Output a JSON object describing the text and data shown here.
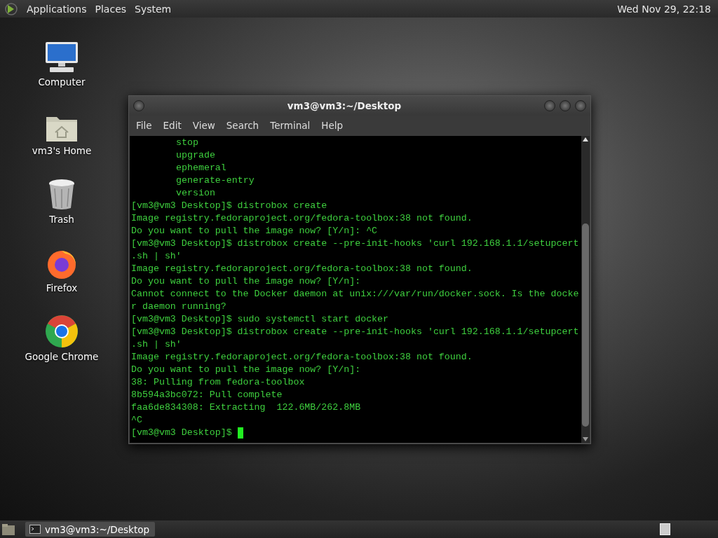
{
  "top_panel": {
    "menus": [
      "Applications",
      "Places",
      "System"
    ],
    "clock": "Wed Nov 29, 22:18"
  },
  "desktop_icons": [
    {
      "kind": "computer",
      "label": "Computer"
    },
    {
      "kind": "home",
      "label": "vm3's Home"
    },
    {
      "kind": "trash",
      "label": "Trash"
    },
    {
      "kind": "firefox",
      "label": "Firefox"
    },
    {
      "kind": "chrome",
      "label": "Google Chrome"
    }
  ],
  "window": {
    "title": "vm3@vm3:~/Desktop",
    "menu": [
      "File",
      "Edit",
      "View",
      "Search",
      "Terminal",
      "Help"
    ],
    "lines": [
      {
        "kind": "indented",
        "text": "stop"
      },
      {
        "kind": "indented",
        "text": "upgrade"
      },
      {
        "kind": "indented",
        "text": "ephemeral"
      },
      {
        "kind": "indented",
        "text": "generate-entry"
      },
      {
        "kind": "indented",
        "text": "version"
      },
      {
        "kind": "plain",
        "text": "[vm3@vm3 Desktop]$ distrobox create"
      },
      {
        "kind": "plain",
        "text": "Image registry.fedoraproject.org/fedora-toolbox:38 not found."
      },
      {
        "kind": "plain",
        "text": "Do you want to pull the image now? [Y/n]: ^C"
      },
      {
        "kind": "plain",
        "text": "[vm3@vm3 Desktop]$ distrobox create --pre-init-hooks 'curl 192.168.1.1/setupcert"
      },
      {
        "kind": "plain",
        "text": ".sh | sh'"
      },
      {
        "kind": "plain",
        "text": "Image registry.fedoraproject.org/fedora-toolbox:38 not found."
      },
      {
        "kind": "plain",
        "text": "Do you want to pull the image now? [Y/n]:"
      },
      {
        "kind": "plain",
        "text": "Cannot connect to the Docker daemon at unix:///var/run/docker.sock. Is the docke"
      },
      {
        "kind": "plain",
        "text": "r daemon running?"
      },
      {
        "kind": "plain",
        "text": "[vm3@vm3 Desktop]$ sudo systemctl start docker"
      },
      {
        "kind": "plain",
        "text": "[vm3@vm3 Desktop]$ distrobox create --pre-init-hooks 'curl 192.168.1.1/setupcert"
      },
      {
        "kind": "plain",
        "text": ".sh | sh'"
      },
      {
        "kind": "plain",
        "text": "Image registry.fedoraproject.org/fedora-toolbox:38 not found."
      },
      {
        "kind": "plain",
        "text": "Do you want to pull the image now? [Y/n]:"
      },
      {
        "kind": "plain",
        "text": "38: Pulling from fedora-toolbox"
      },
      {
        "kind": "plain",
        "text": "8b594a3bc072: Pull complete"
      },
      {
        "kind": "plain",
        "text": "faa6de834308: Extracting  122.6MB/262.8MB"
      },
      {
        "kind": "plain",
        "text": "^C"
      },
      {
        "kind": "prompt",
        "text": "[vm3@vm3 Desktop]$"
      }
    ]
  },
  "taskbar": {
    "tasks": [
      {
        "label": "vm3@vm3:~/Desktop",
        "selected": true
      }
    ]
  }
}
